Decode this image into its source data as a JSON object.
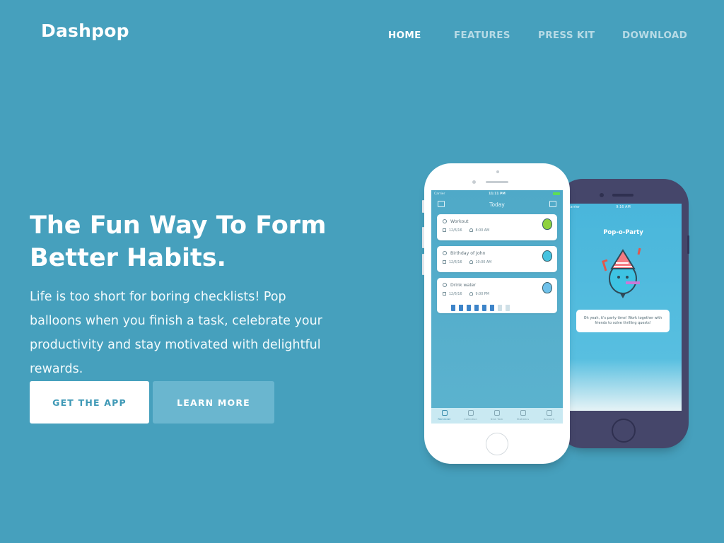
{
  "brand": {
    "name": "Dashpop"
  },
  "nav": {
    "items": [
      {
        "label": "HOME",
        "active": true
      },
      {
        "label": "FEATURES",
        "active": false
      },
      {
        "label": "PRESS KIT",
        "active": false
      },
      {
        "label": "DOWNLOAD",
        "active": false
      }
    ]
  },
  "hero": {
    "title_line1": "The Fun Way To Form",
    "title_line2": "Better Habits.",
    "description": "Life is too short for boring checklists! Pop balloons when you finish a task, celebrate your productivity and stay motivated with delightful rewards.",
    "primary_button": "GET THE APP",
    "secondary_button": "LEARN MORE"
  },
  "phone_front": {
    "status": {
      "carrier": "Carrier",
      "time": "11:11 PM"
    },
    "header_title": "Today",
    "tasks": [
      {
        "name": "Workout",
        "date": "12/6/16",
        "time": "8:00 AM",
        "balloon_color": "#8fd13f"
      },
      {
        "name": "Birthday of John",
        "date": "12/6/16",
        "time": "10:00 AM",
        "balloon_color": "#46c3e0"
      },
      {
        "name": "Drink water",
        "date": "12/6/16",
        "time": "9:00 PM",
        "balloon_color": "#6fc1ea",
        "progress": {
          "filled": 6,
          "total": 8
        }
      }
    ],
    "tabs": [
      {
        "label": "Reminder",
        "active": true
      },
      {
        "label": "Collection",
        "active": false
      },
      {
        "label": "New Task",
        "active": false
      },
      {
        "label": "Statistics",
        "active": false
      },
      {
        "label": "Account",
        "active": false
      }
    ]
  },
  "phone_back": {
    "status": {
      "carrier": "Carrier",
      "time": "9:16 AM"
    },
    "title": "Pop-o-Party",
    "message": "Oh yeah, it's party time! Work together with friends to solve thrilling quests!"
  },
  "colors": {
    "background": "#46a0bd",
    "primary_button_text": "#3f99b6",
    "secondary_button_bg": "#6ab6cf",
    "dark_phone": "#45466a"
  }
}
